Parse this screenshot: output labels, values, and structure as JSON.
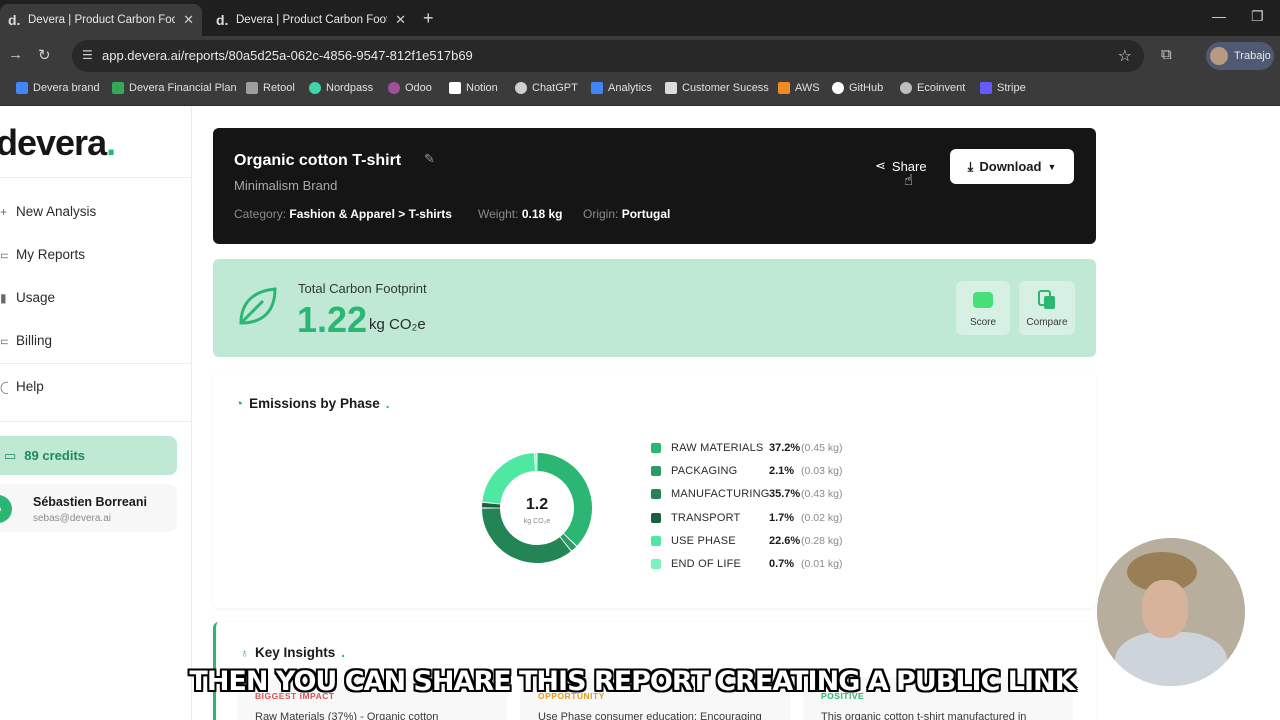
{
  "browser": {
    "tabs": [
      {
        "favicon": "d.",
        "title": "Devera | Product Carbon Footp"
      },
      {
        "favicon": "d.",
        "title": "Devera | Product Carbon Footp"
      }
    ],
    "url": "app.devera.ai/reports/80a5d25a-062c-4856-9547-812f1e517b69",
    "profile": "Trabajo",
    "bookmarks": [
      "Devera brand",
      "Devera Financial Plan",
      "Retool",
      "Nordpass",
      "Odoo",
      "Notion",
      "ChatGPT",
      "Analytics",
      "Customer Sucess",
      "AWS",
      "GitHub",
      "Ecoinvent",
      "Stripe"
    ]
  },
  "sidebar": {
    "logo": "devera",
    "logo_dot": ".",
    "nav": [
      "New Analysis",
      "My Reports",
      "Usage",
      "Billing",
      "Help"
    ],
    "credits": "89 credits",
    "user": {
      "name": "Sébastien Borreani",
      "email": "sebas@devera.ai"
    }
  },
  "product": {
    "title": "Organic cotton T-shirt",
    "brand": "Minimalism Brand",
    "category_label": "Category:",
    "category": "Fashion & Apparel > T-shirts",
    "weight_label": "Weight:",
    "weight": "0.18 kg",
    "origin_label": "Origin:",
    "origin": "Portugal",
    "share_label": "Share",
    "download_label": "Download"
  },
  "footprint": {
    "label": "Total Carbon Footprint",
    "value": "1.22",
    "unit": "kg CO₂e",
    "score_label": "Score",
    "compare_label": "Compare"
  },
  "emissions": {
    "title": "Emissions by Phase",
    "center_value": "1.2",
    "center_unit": "kg CO₂e",
    "phases": [
      {
        "name": "RAW MATERIALS",
        "pct": "37.2%",
        "kg": "(0.45 kg)",
        "share": 37.2,
        "color": "#2bb673"
      },
      {
        "name": "PACKAGING",
        "pct": "2.1%",
        "kg": "(0.03 kg)",
        "share": 2.1,
        "color": "#2a9d66"
      },
      {
        "name": "MANUFACTURING",
        "pct": "35.7%",
        "kg": "(0.43 kg)",
        "share": 35.7,
        "color": "#238456"
      },
      {
        "name": "TRANSPORT",
        "pct": "1.7%",
        "kg": "(0.02 kg)",
        "share": 1.7,
        "color": "#1c5e40"
      },
      {
        "name": "USE PHASE",
        "pct": "22.6%",
        "kg": "(0.28 kg)",
        "share": 22.6,
        "color": "#4ee8a3"
      },
      {
        "name": "END OF LIFE",
        "pct": "0.7%",
        "kg": "(0.01 kg)",
        "share": 0.7,
        "color": "#79f2bd"
      }
    ]
  },
  "insights": {
    "title": "Key Insights",
    "cards": [
      {
        "tag": "BIGGEST IMPACT",
        "tag_color": "#d9534f",
        "text": "Raw Materials (37%) - Organic cotton"
      },
      {
        "tag": "OPPORTUNITY",
        "tag_color": "#e0a020",
        "text": "Use Phase consumer education: Encouraging"
      },
      {
        "tag": "POSITIVE",
        "tag_color": "#2bb673",
        "text": "This organic cotton t-shirt manufactured in"
      }
    ]
  },
  "caption": "THEN YOU CAN SHARE THIS REPORT CREATING A PUBLIC LINK"
}
